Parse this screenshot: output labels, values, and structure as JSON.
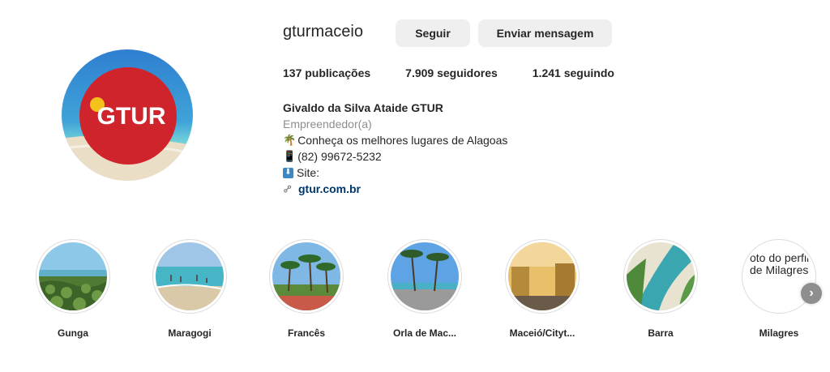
{
  "profile": {
    "username": "gturmaceio",
    "follow_label": "Seguir",
    "message_label": "Enviar mensagem",
    "avatar_logo_text": "GTUR"
  },
  "stats": {
    "posts": "137 publicações",
    "followers": "7.909 seguidores",
    "following": "1.241 seguindo"
  },
  "bio": {
    "full_name": "Givaldo da Silva Ataide GTUR",
    "category": "Empreendedor(a)",
    "line1_icon": "🌴",
    "line1": "Conheça os melhores lugares de Alagoas",
    "line2_icon": "📱",
    "line2": "(82) 99672-5232",
    "line3_icon": "⬇",
    "line3": "Site:",
    "website": "gtur.com.br"
  },
  "highlights": [
    {
      "label": "Gunga"
    },
    {
      "label": "Maragogi"
    },
    {
      "label": "Francês"
    },
    {
      "label": "Orla de Mac..."
    },
    {
      "label": "Maceió/Cityt..."
    },
    {
      "label": "Barra"
    },
    {
      "label": "Milagres",
      "alt_text": "oto do perfil de Milagres"
    }
  ],
  "icons": {
    "chain": "link-icon",
    "next": "chevron-right-icon"
  },
  "colors": {
    "button_bg": "#efefef",
    "link": "#00376b",
    "muted": "#8e8e8e",
    "logo_red": "#d0242c"
  }
}
